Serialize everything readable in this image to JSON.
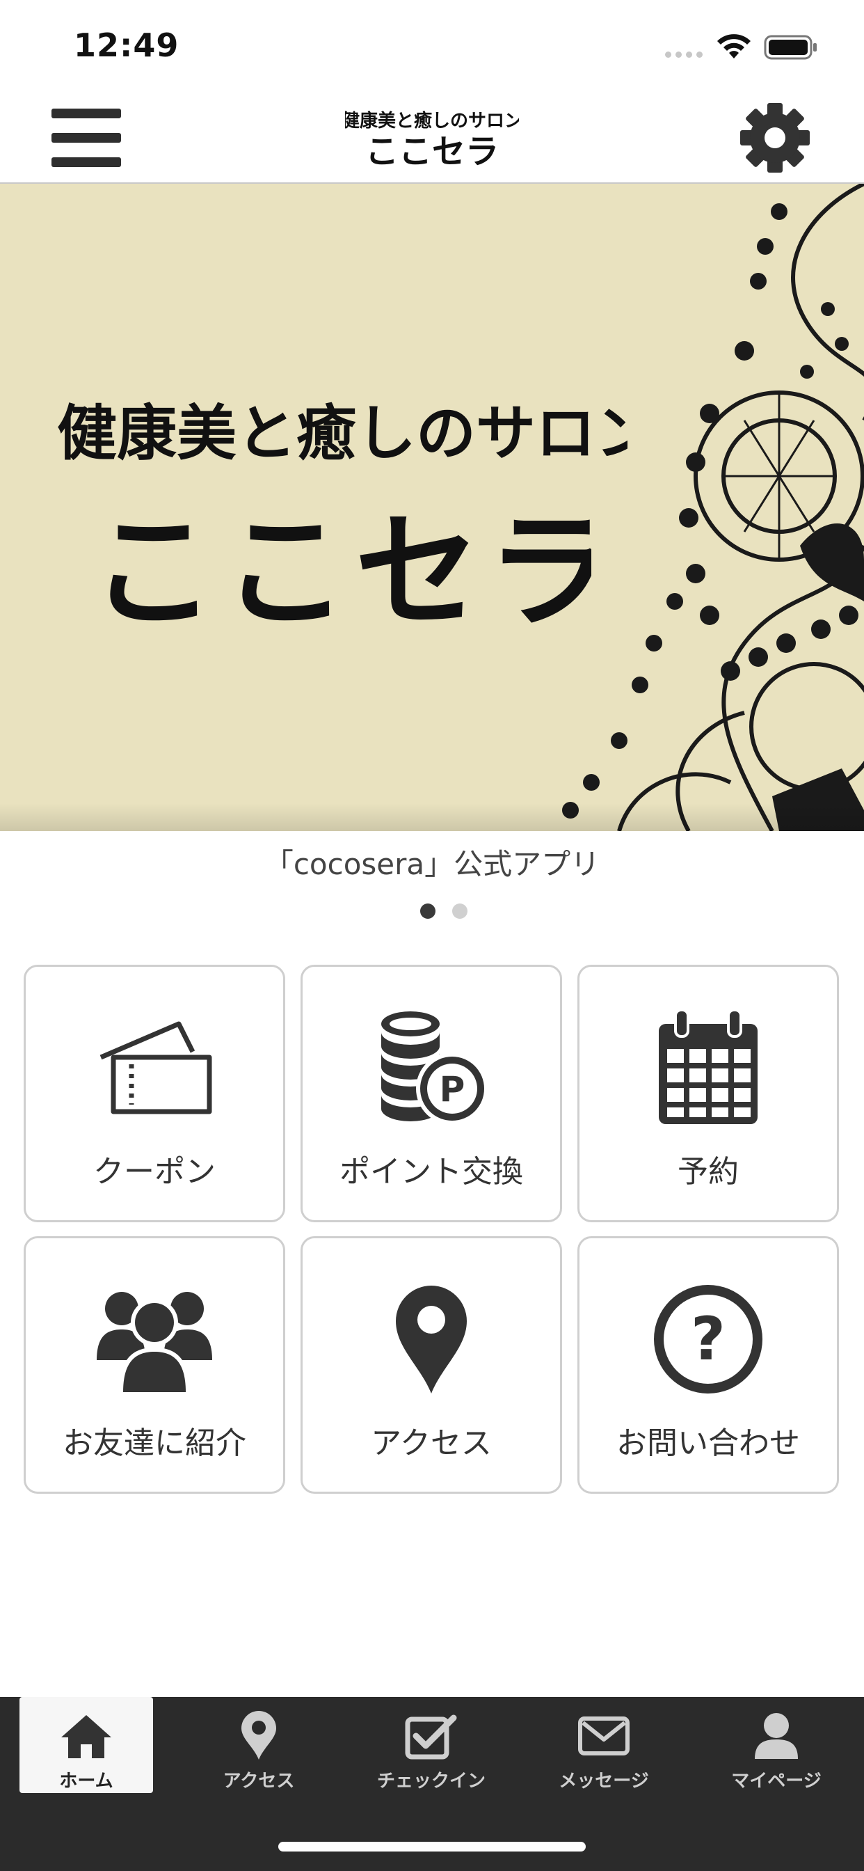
{
  "status_bar": {
    "time": "12:49"
  },
  "header": {
    "logo_line1": "健康美と癒しのサロン",
    "logo_line2": "ここセラ"
  },
  "banner": {
    "title_line1": "健康美と癒しのサロン",
    "title_line2": "ここセラ",
    "caption": "「cocosera」公式アプリ",
    "page_count": 2,
    "active_page": 1
  },
  "menu": {
    "tiles": [
      {
        "label": "クーポン",
        "icon": "ticket-icon"
      },
      {
        "label": "ポイント交換",
        "icon": "coins-point-icon"
      },
      {
        "label": "予約",
        "icon": "calendar-icon"
      },
      {
        "label": "お友達に紹介",
        "icon": "group-icon"
      },
      {
        "label": "アクセス",
        "icon": "map-pin-icon"
      },
      {
        "label": "お問い合わせ",
        "icon": "question-circle-icon"
      }
    ]
  },
  "tab_bar": {
    "items": [
      {
        "label": "ホーム",
        "icon": "home-icon",
        "active": true
      },
      {
        "label": "アクセス",
        "icon": "map-pin-icon",
        "active": false
      },
      {
        "label": "チェックイン",
        "icon": "checkbox-icon",
        "active": false
      },
      {
        "label": "メッセージ",
        "icon": "envelope-icon",
        "active": false
      },
      {
        "label": "マイページ",
        "icon": "person-icon",
        "active": false
      }
    ]
  },
  "colors": {
    "banner_bg": "#e9e2bf",
    "tab_bar_bg": "#2b2b2b",
    "icon": "#333333"
  }
}
